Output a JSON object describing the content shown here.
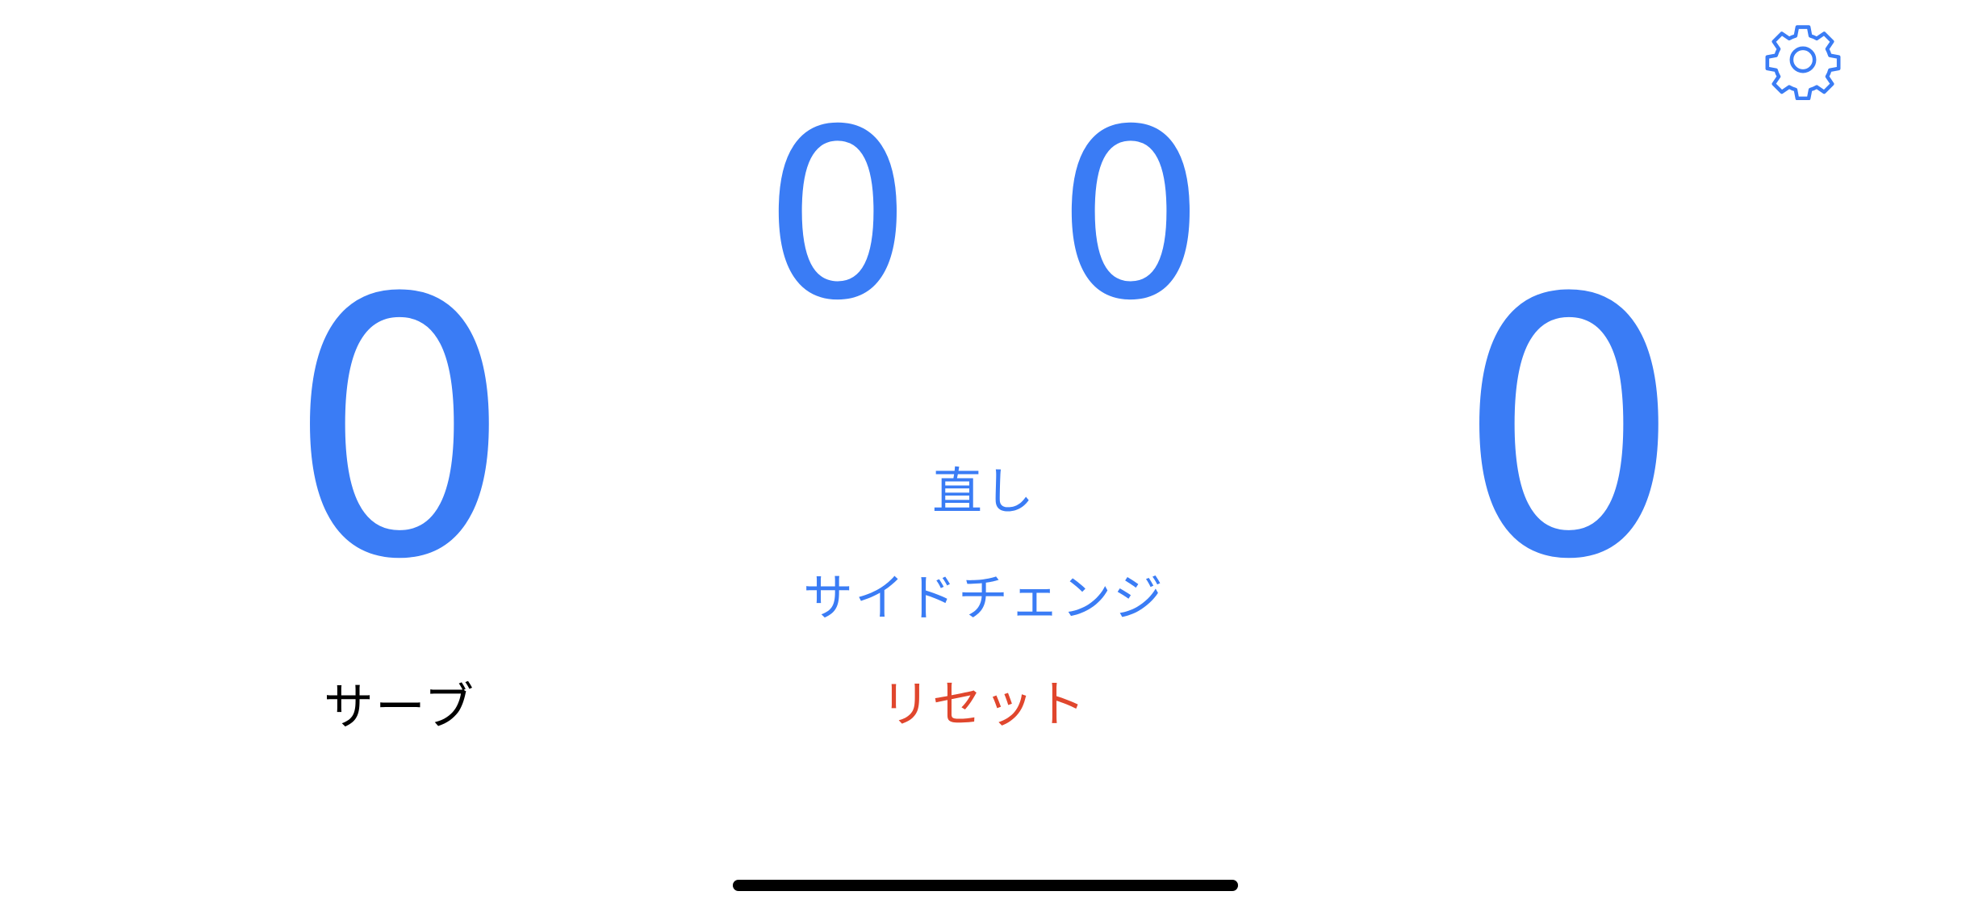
{
  "colors": {
    "accent": "#3a7cf5",
    "danger": "#e0462d",
    "text": "#000000",
    "background": "#ffffff",
    "home_indicator": "#000000"
  },
  "scores": {
    "left_points": "0",
    "right_points": "0",
    "left_games": "0",
    "right_games": "0"
  },
  "serve_label": "サーブ",
  "actions": {
    "undo_label": "直し",
    "side_change_label": "サイドチェンジ",
    "reset_label": "リセット"
  },
  "icons": {
    "settings": "gear-icon"
  }
}
